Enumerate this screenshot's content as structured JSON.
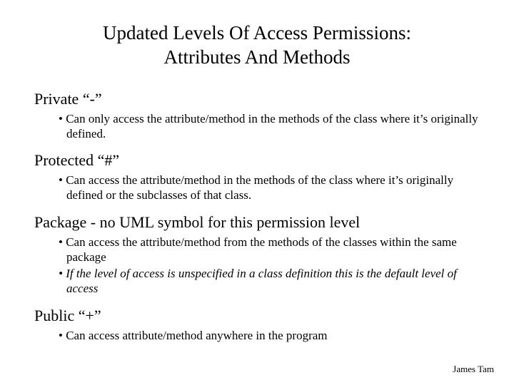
{
  "title_line1": "Updated Levels Of Access Permissions:",
  "title_line2": "Attributes And Methods",
  "sections": [
    {
      "heading": "Private “-”",
      "bullets": [
        {
          "text": "Can only access the attribute/method in the methods of the class where it’s originally defined.",
          "italic": false
        }
      ]
    },
    {
      "heading": "Protected “#”",
      "bullets": [
        {
          "text": "Can access the attribute/method in the methods of the class where it’s originally defined or the subclasses of that class.",
          "italic": false
        }
      ]
    },
    {
      "heading": "Package - no UML symbol for this permission level",
      "bullets": [
        {
          "text": "Can access the attribute/method from the methods of the classes within the same package",
          "italic": false
        },
        {
          "text": "If the level of access is unspecified in a class definition this is the default level of access",
          "italic": true
        }
      ]
    },
    {
      "heading": "Public “+”",
      "bullets": [
        {
          "text": "Can access attribute/method anywhere in the program",
          "italic": false
        }
      ]
    }
  ],
  "footer": "James Tam"
}
